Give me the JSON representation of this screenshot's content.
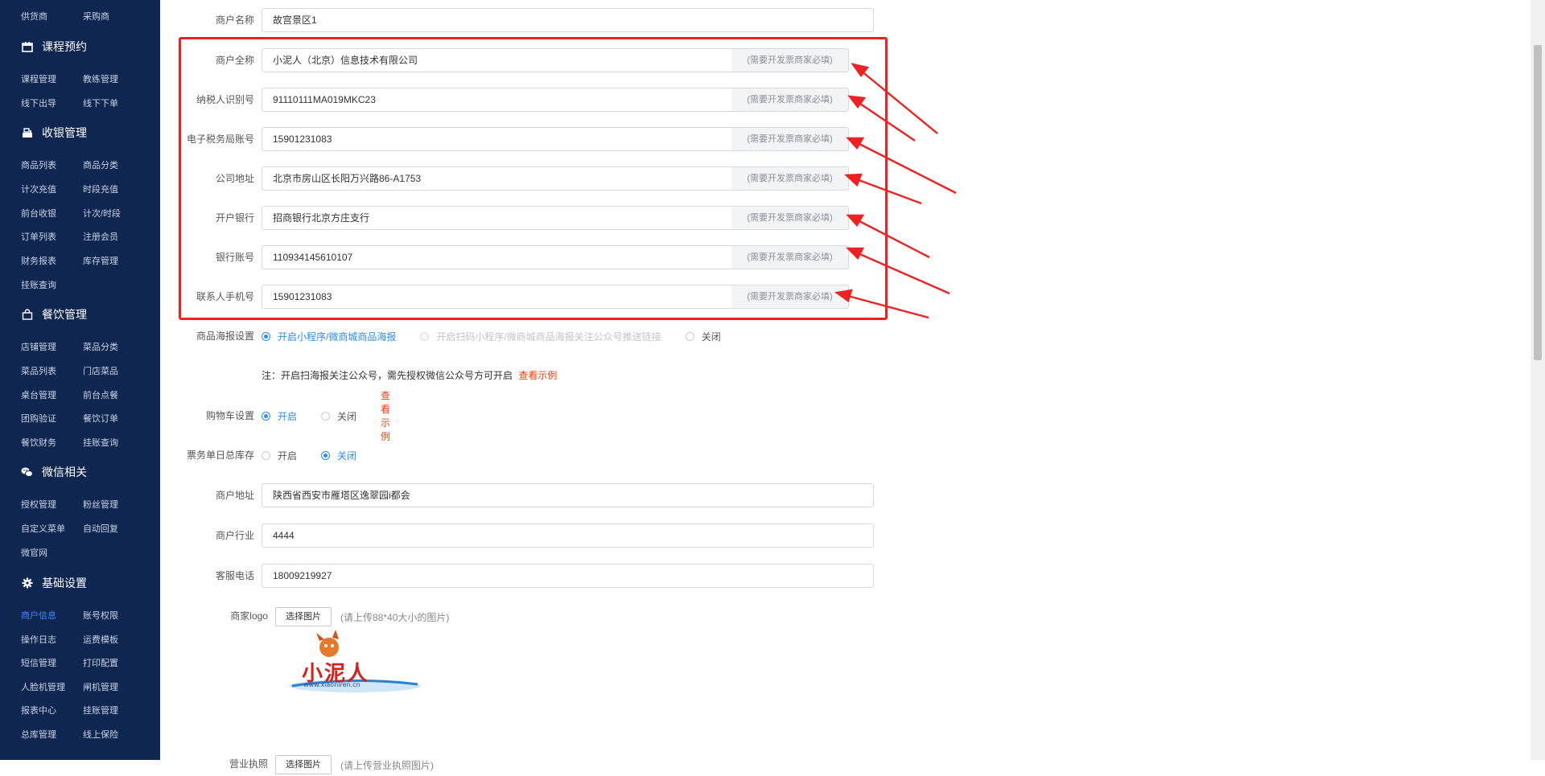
{
  "sidebar": {
    "top_items": [
      "供货商",
      "采购商"
    ],
    "sections": [
      {
        "title": "课程预约",
        "icon": "calendar-icon",
        "items": [
          "课程管理",
          "教练管理",
          "线下出导",
          "线下下单"
        ]
      },
      {
        "title": "收银管理",
        "icon": "cashier-icon",
        "items": [
          "商品列表",
          "商品分类",
          "计次充值",
          "时段充值",
          "前台收银",
          "计次/时段",
          "订单列表",
          "注册会员",
          "财务报表",
          "库存管理",
          "挂账查询"
        ]
      },
      {
        "title": "餐饮管理",
        "icon": "bag-icon",
        "items": [
          "店铺管理",
          "菜品分类",
          "菜品列表",
          "门店菜品",
          "桌台管理",
          "前台点餐",
          "团购验证",
          "餐饮订单",
          "餐饮财务",
          "挂账查询"
        ]
      },
      {
        "title": "微信相关",
        "icon": "wechat-icon",
        "items": [
          "授权管理",
          "粉丝管理",
          "自定义菜单",
          "自动回复",
          "微官网"
        ]
      },
      {
        "title": "基础设置",
        "icon": "gear-icon",
        "items": [
          "商户信息",
          "账号权限",
          "操作日志",
          "运费模板",
          "短信管理",
          "打印配置",
          "人脸机管理",
          "闸机管理",
          "报表中心",
          "挂账管理",
          "总库管理",
          "线上保险"
        ],
        "active_item": "商户信息"
      }
    ]
  },
  "form": {
    "merchant_name": {
      "label": "商户名称",
      "value": "故宫景区1"
    },
    "invoice_fields": [
      {
        "label": "商户全称",
        "value": "小泥人（北京）信息技术有限公司",
        "addon": "(需要开发票商家必填)"
      },
      {
        "label": "纳税人识别号",
        "value": "91110111MA019MKC23",
        "addon": "(需要开发票商家必填)"
      },
      {
        "label": "电子税务局账号",
        "value": "15901231083",
        "addon": "(需要开发票商家必填)"
      },
      {
        "label": "公司地址",
        "value": "北京市房山区长阳万兴路86-A1753",
        "addon": "(需要开发票商家必填)"
      },
      {
        "label": "开户银行",
        "value": "招商银行北京方庄支行",
        "addon": "(需要开发票商家必填)"
      },
      {
        "label": "银行账号",
        "value": "110934145610107",
        "addon": "(需要开发票商家必填)"
      },
      {
        "label": "联系人手机号",
        "value": "15901231083",
        "addon": "(需要开发票商家必填)"
      }
    ],
    "poster": {
      "label": "商品海报设置",
      "options": [
        "开启小程序/微商城商品海报",
        "开启扫码小程序/微商城商品海报关注公众号推送链接",
        "关闭"
      ],
      "selected": 0,
      "disabled": [
        1
      ],
      "note": "注：开启扫海报关注公众号，需先授权微信公众号方可开启",
      "example_link": "查看示例"
    },
    "cart": {
      "label": "购物车设置",
      "options": [
        "开启",
        "关闭"
      ],
      "selected": 0,
      "example_link": "查看示例"
    },
    "ticket_stock": {
      "label": "票务单日总库存",
      "options": [
        "开启",
        "关闭"
      ],
      "selected": 1
    },
    "merchant_address": {
      "label": "商户地址",
      "value": "陕西省西安市雁塔区逸翠园i都会"
    },
    "merchant_industry": {
      "label": "商户行业",
      "value": "4444"
    },
    "service_phone": {
      "label": "客服电话",
      "value": "18009219927"
    },
    "logo": {
      "label": "商家logo",
      "button": "选择图片",
      "hint": "(请上传88*40大小的图片)",
      "logo_text": "小泥人",
      "logo_url_text": "www.xiaoniren.cn"
    },
    "license": {
      "label": "营业执照",
      "button": "选择图片",
      "hint": "(请上传营业执照图片)"
    }
  },
  "colors": {
    "sidebar_bg": "#0e2650",
    "active": "#3d8bff",
    "highlight": "#ee2222",
    "radio_checked": "#2d8cf0",
    "link_red": "#ed4014"
  }
}
